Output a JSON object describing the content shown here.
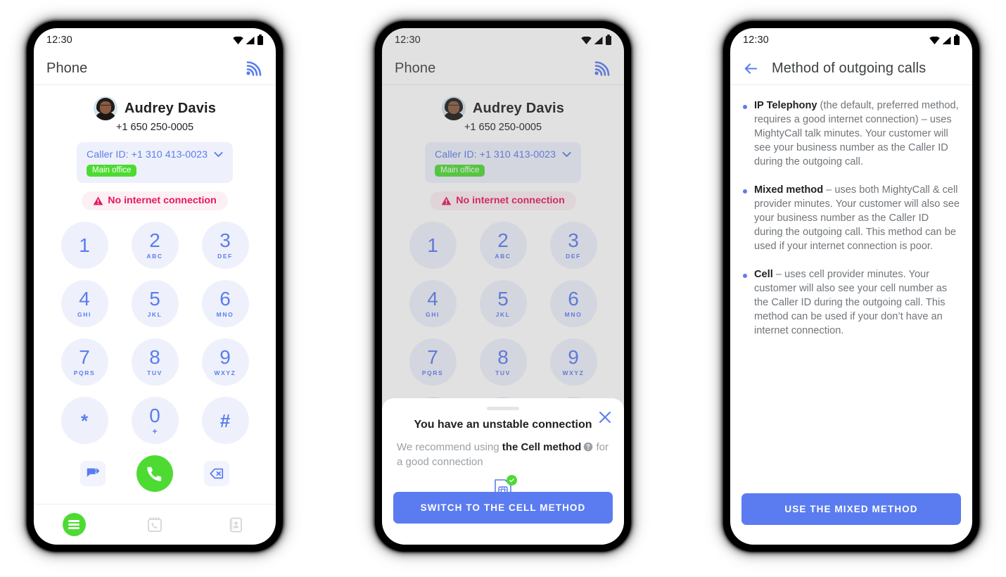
{
  "phone1": {
    "status": {
      "time": "12:30",
      "icons": [
        "wifi-icon",
        "signal-icon",
        "battery-icon"
      ]
    },
    "appbar": {
      "title": "Phone",
      "action_icon": "broadcast-signal-icon"
    },
    "contact": {
      "name": "Audrey Davis",
      "phone": "+1 650 250-0005"
    },
    "caller_id": {
      "label": "Caller ID: +1 310 413-0023",
      "tag": "Main office"
    },
    "warning": "No internet connection",
    "dialpad": [
      {
        "digit": "1",
        "letters": ""
      },
      {
        "digit": "2",
        "letters": "ABC"
      },
      {
        "digit": "3",
        "letters": "DEF"
      },
      {
        "digit": "4",
        "letters": "GHI"
      },
      {
        "digit": "5",
        "letters": "JKL"
      },
      {
        "digit": "6",
        "letters": "MNO"
      },
      {
        "digit": "7",
        "letters": "PQRS"
      },
      {
        "digit": "8",
        "letters": "TUV"
      },
      {
        "digit": "9",
        "letters": "WXYZ"
      },
      {
        "digit": "*",
        "letters": ""
      },
      {
        "digit": "0",
        "letters": "+"
      },
      {
        "digit": "#",
        "letters": ""
      }
    ],
    "actions": {
      "message_icon": "message-icon",
      "call_icon": "call-icon",
      "backspace_icon": "backspace-icon"
    },
    "nav": [
      {
        "name": "dialpad",
        "icon": "dialpad-menu-icon",
        "active": true
      },
      {
        "name": "history",
        "icon": "call-history-icon",
        "active": false
      },
      {
        "name": "contacts",
        "icon": "contacts-book-icon",
        "active": false
      }
    ]
  },
  "phone2": {
    "status": {
      "time": "12:30"
    },
    "appbar": {
      "title": "Phone"
    },
    "contact": {
      "name": "Audrey Davis",
      "phone": "+1 650 250-0005"
    },
    "caller_id": {
      "label": "Caller ID: +1 310 413-0023",
      "tag": "Main office"
    },
    "warning": "No internet connection",
    "sheet": {
      "title": "You have an unstable connection",
      "body_pre": "We recommend using ",
      "body_bold": "the Cell method",
      "body_post": " for a good connection",
      "help_icon": "help-circle-icon",
      "sim_icon": "sim-card-icon",
      "sim_badge_icon": "check-badge-icon",
      "close_icon": "close-icon",
      "button": "SWITCH TO THE CELL METHOD"
    }
  },
  "phone3": {
    "status": {
      "time": "12:30"
    },
    "appbar": {
      "title": "Method of outgoing calls",
      "back_icon": "back-arrow-icon"
    },
    "items": [
      {
        "term": "IP Telephony",
        "rest": " (the default, preferred method, requires a good internet connection) – uses MightyCall talk minutes. Your customer will see your business number as the Caller ID during the outgoing call."
      },
      {
        "term": "Mixed method",
        "rest": " – uses both MightyCall & cell provider minutes. Your customer will also see your business number as the Caller ID during the outgoing call. This method can be used if your internet connection is poor."
      },
      {
        "term": "Cell",
        "rest": " – uses cell provider minutes. Your customer will also see your cell number as the Caller ID during the outgoing call. This method can be used if your don’t have an internet connection."
      }
    ],
    "button": "USE THE MIXED METHOD"
  },
  "colors": {
    "accent_blue": "#5b7cf0",
    "key_bg": "#eef1fb",
    "green": "#4ddb32",
    "warn_pink": "#e8175d",
    "warn_pink_bg": "#fdf0f4",
    "muted_text": "#70757a"
  }
}
